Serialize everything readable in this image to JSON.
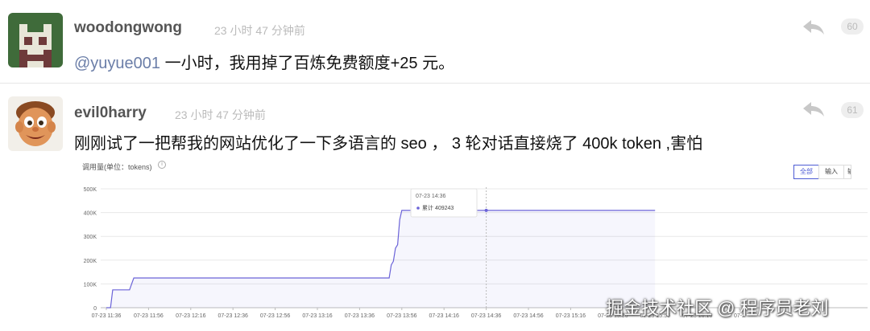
{
  "replies": [
    {
      "username": "woodongwong",
      "time": "23 小时 47 分钟前",
      "mention": "@yuyue001",
      "text": " 一小时，我用掉了百炼免费额度+25 元。",
      "floor": "60"
    },
    {
      "username": "evil0harry",
      "time": "23 小时 47 分钟前",
      "text": "刚刚试了一把帮我的网站优化了一下多语言的 seo ， 3 轮对话直接烧了 400k token ,害怕",
      "floor": "61"
    }
  ],
  "chart_header": {
    "title": "调用量(单位：tokens)",
    "info_glyph": "i",
    "tabs": [
      "全部",
      "输入",
      "输"
    ]
  },
  "chart_data": {
    "type": "area",
    "title": "调用量(单位：tokens)",
    "x": [
      "07-23 11:36",
      "07-23 11:46",
      "07-23 11:56",
      "07-23 12:06",
      "07-23 12:16",
      "07-23 12:26",
      "07-23 12:36",
      "07-23 12:46",
      "07-23 12:56",
      "07-23 13:06",
      "07-23 13:16",
      "07-23 13:26",
      "07-23 13:36",
      "07-23 13:46",
      "07-23 13:56",
      "07-23 14:06",
      "07-23 14:16",
      "07-23 14:26",
      "07-23 14:36",
      "07-23 14:46",
      "07-23 14:56",
      "07-23 15:06",
      "07-23 15:16",
      "07-23 15:26",
      "07-23 15:36",
      "07-23 15:46",
      "07-23 15:56"
    ],
    "x_tick_labels": [
      "07-23 11:36",
      "07-23 11:56",
      "07-23 12:16",
      "07-23 12:36",
      "07-23 12:56",
      "07-23 13:16",
      "07-23 13:36",
      "07-23 13:56",
      "07-23 14:16",
      "07-23 14:36",
      "07-23 14:56",
      "07-23 15:16",
      "07-23 15:36",
      "07-23 15:56",
      "07-23 16:16",
      "07-2"
    ],
    "y_ticks": [
      "0",
      "100K",
      "200K",
      "300K",
      "400K",
      "500K"
    ],
    "ylim": [
      0,
      500000
    ],
    "series": [
      {
        "name": "累计",
        "color": "#6b63d8",
        "points": [
          [
            "07-23 11:36",
            0
          ],
          [
            "07-23 11:38",
            0
          ],
          [
            "07-23 11:39",
            75000
          ],
          [
            "07-23 11:47",
            75000
          ],
          [
            "07-23 11:48",
            100000
          ],
          [
            "07-23 11:49",
            125000
          ],
          [
            "07-23 13:50",
            125000
          ],
          [
            "07-23 13:51",
            180000
          ],
          [
            "07-23 13:52",
            195000
          ],
          [
            "07-23 13:53",
            250000
          ],
          [
            "07-23 13:54",
            265000
          ],
          [
            "07-23 13:55",
            370000
          ],
          [
            "07-23 13:56",
            409243
          ],
          [
            "07-23 15:56",
            409243
          ]
        ]
      }
    ],
    "tooltip": {
      "time": "07-23 14:36",
      "label": "累计",
      "value": "409243"
    },
    "grid": true
  },
  "watermark": "掘金技术社区 @ 程序员老刘"
}
